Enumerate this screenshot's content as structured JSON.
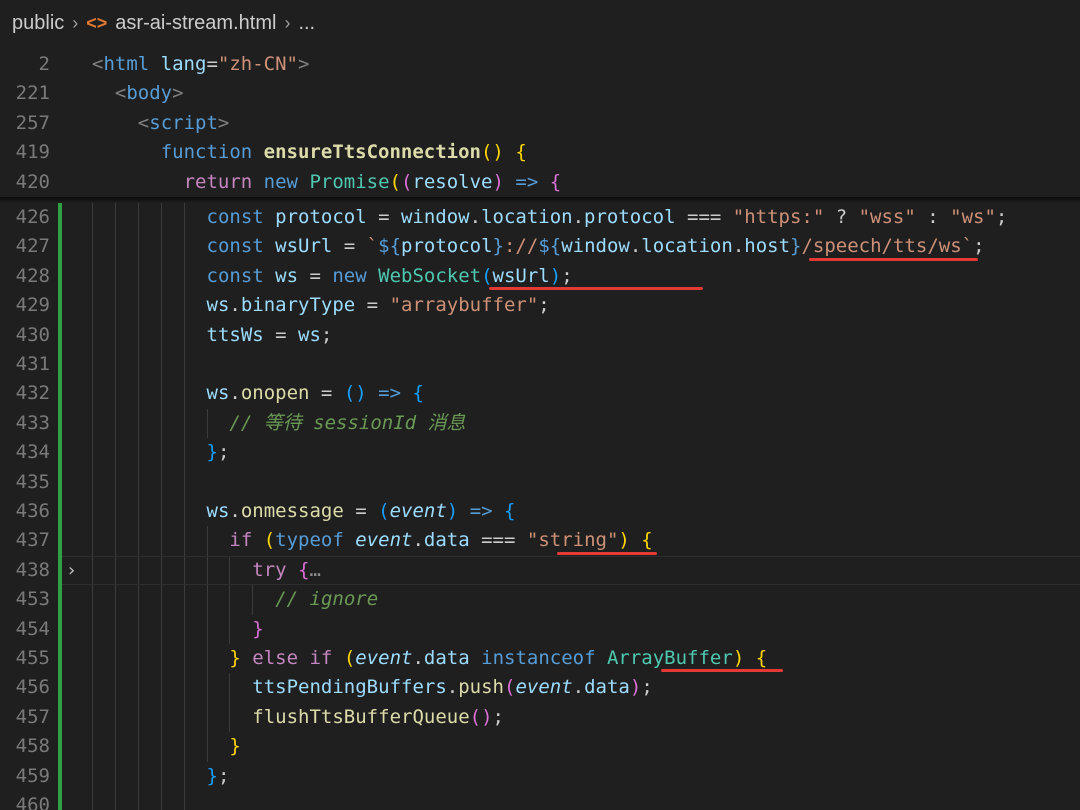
{
  "breadcrumb": {
    "folder": "public",
    "file": "asr-ai-stream.html",
    "more": "..."
  },
  "sticky": [
    {
      "ln": "2",
      "tokens": [
        {
          "c": "br",
          "t": "<"
        },
        {
          "c": "tag",
          "t": "html"
        },
        {
          "c": "sp",
          "t": " "
        },
        {
          "c": "attr",
          "t": "lang"
        },
        {
          "c": "pl",
          "t": "="
        },
        {
          "c": "str",
          "t": "\"zh-CN\""
        },
        {
          "c": "br",
          "t": ">"
        }
      ],
      "indent": 0
    },
    {
      "ln": "221",
      "tokens": [
        {
          "c": "br",
          "t": "<"
        },
        {
          "c": "tag",
          "t": "body"
        },
        {
          "c": "br",
          "t": ">"
        }
      ],
      "indent": 1
    },
    {
      "ln": "257",
      "tokens": [
        {
          "c": "br",
          "t": "<"
        },
        {
          "c": "tag",
          "t": "script"
        },
        {
          "c": "br",
          "t": ">"
        }
      ],
      "indent": 2
    },
    {
      "ln": "419",
      "tokens": [
        {
          "c": "kw",
          "t": "function "
        },
        {
          "c": "fnb",
          "t": "ensureTtsConnection"
        },
        {
          "c": "p1",
          "t": "()"
        },
        {
          "c": "pl",
          "t": " "
        },
        {
          "c": "p1",
          "t": "{"
        }
      ],
      "indent": 3
    },
    {
      "ln": "420",
      "tokens": [
        {
          "c": "ctl",
          "t": "return "
        },
        {
          "c": "kw",
          "t": "new "
        },
        {
          "c": "cls",
          "t": "Promise"
        },
        {
          "c": "p1",
          "t": "("
        },
        {
          "c": "p2",
          "t": "("
        },
        {
          "c": "var",
          "t": "resolve"
        },
        {
          "c": "p2",
          "t": ")"
        },
        {
          "c": "pl",
          "t": " "
        },
        {
          "c": "kw",
          "t": "=>"
        },
        {
          "c": "pl",
          "t": " "
        },
        {
          "c": "p2",
          "t": "{"
        }
      ],
      "indent": 4
    }
  ],
  "lines": [
    {
      "ln": "426",
      "indent": 5,
      "tokens": [
        {
          "c": "kw",
          "t": "const "
        },
        {
          "c": "var",
          "t": "protocol"
        },
        {
          "c": "pl",
          "t": " = "
        },
        {
          "c": "var",
          "t": "window"
        },
        {
          "c": "pl",
          "t": "."
        },
        {
          "c": "var",
          "t": "location"
        },
        {
          "c": "pl",
          "t": "."
        },
        {
          "c": "var",
          "t": "protocol"
        },
        {
          "c": "pl",
          "t": " === "
        },
        {
          "c": "str",
          "t": "\"https:\""
        },
        {
          "c": "pl",
          "t": " ? "
        },
        {
          "c": "str",
          "t": "\"wss\""
        },
        {
          "c": "pl",
          "t": " : "
        },
        {
          "c": "str",
          "t": "\"ws\""
        },
        {
          "c": "pl",
          "t": ";"
        }
      ]
    },
    {
      "ln": "427",
      "indent": 5,
      "tokens": [
        {
          "c": "kw",
          "t": "const "
        },
        {
          "c": "var",
          "t": "wsUrl"
        },
        {
          "c": "pl",
          "t": " = "
        },
        {
          "c": "str",
          "t": "`"
        },
        {
          "c": "kw",
          "t": "${"
        },
        {
          "c": "var",
          "t": "protocol"
        },
        {
          "c": "kw",
          "t": "}"
        },
        {
          "c": "str",
          "t": "://"
        },
        {
          "c": "kw",
          "t": "${"
        },
        {
          "c": "var",
          "t": "window"
        },
        {
          "c": "pl",
          "t": "."
        },
        {
          "c": "var",
          "t": "location"
        },
        {
          "c": "pl",
          "t": "."
        },
        {
          "c": "var",
          "t": "host"
        },
        {
          "c": "kw",
          "t": "}"
        },
        {
          "c": "str",
          "t": "/speech/tts/ws`"
        },
        {
          "c": "pl",
          "t": ";"
        }
      ]
    },
    {
      "ln": "428",
      "indent": 5,
      "tokens": [
        {
          "c": "kw",
          "t": "const "
        },
        {
          "c": "var",
          "t": "ws"
        },
        {
          "c": "pl",
          "t": " = "
        },
        {
          "c": "kw",
          "t": "new "
        },
        {
          "c": "cls",
          "t": "WebSocket"
        },
        {
          "c": "p3",
          "t": "("
        },
        {
          "c": "var",
          "t": "wsUrl"
        },
        {
          "c": "p3",
          "t": ")"
        },
        {
          "c": "pl",
          "t": ";"
        }
      ]
    },
    {
      "ln": "429",
      "indent": 5,
      "tokens": [
        {
          "c": "var",
          "t": "ws"
        },
        {
          "c": "pl",
          "t": "."
        },
        {
          "c": "var",
          "t": "binaryType"
        },
        {
          "c": "pl",
          "t": " = "
        },
        {
          "c": "str",
          "t": "\"arraybuffer\""
        },
        {
          "c": "pl",
          "t": ";"
        }
      ]
    },
    {
      "ln": "430",
      "indent": 5,
      "tokens": [
        {
          "c": "var",
          "t": "ttsWs"
        },
        {
          "c": "pl",
          "t": " = "
        },
        {
          "c": "var",
          "t": "ws"
        },
        {
          "c": "pl",
          "t": ";"
        }
      ]
    },
    {
      "ln": "431",
      "indent": 5,
      "tokens": []
    },
    {
      "ln": "432",
      "indent": 5,
      "tokens": [
        {
          "c": "var",
          "t": "ws"
        },
        {
          "c": "pl",
          "t": "."
        },
        {
          "c": "fn",
          "t": "onopen"
        },
        {
          "c": "pl",
          "t": " = "
        },
        {
          "c": "p3",
          "t": "()"
        },
        {
          "c": "pl",
          "t": " "
        },
        {
          "c": "kw",
          "t": "=>"
        },
        {
          "c": "pl",
          "t": " "
        },
        {
          "c": "p3",
          "t": "{"
        }
      ]
    },
    {
      "ln": "433",
      "indent": 6,
      "tokens": [
        {
          "c": "cm",
          "t": "// 等待 sessionId 消息"
        }
      ]
    },
    {
      "ln": "434",
      "indent": 5,
      "tokens": [
        {
          "c": "p3",
          "t": "}"
        },
        {
          "c": "pl",
          "t": ";"
        }
      ]
    },
    {
      "ln": "435",
      "indent": 5,
      "tokens": []
    },
    {
      "ln": "436",
      "indent": 5,
      "tokens": [
        {
          "c": "var",
          "t": "ws"
        },
        {
          "c": "pl",
          "t": "."
        },
        {
          "c": "fn",
          "t": "onmessage"
        },
        {
          "c": "pl",
          "t": " = "
        },
        {
          "c": "p3",
          "t": "("
        },
        {
          "c": "vari",
          "t": "event"
        },
        {
          "c": "p3",
          "t": ")"
        },
        {
          "c": "pl",
          "t": " "
        },
        {
          "c": "kw",
          "t": "=>"
        },
        {
          "c": "pl",
          "t": " "
        },
        {
          "c": "p3",
          "t": "{"
        }
      ]
    },
    {
      "ln": "437",
      "indent": 6,
      "tokens": [
        {
          "c": "ctl",
          "t": "if "
        },
        {
          "c": "p1",
          "t": "("
        },
        {
          "c": "kw",
          "t": "typeof "
        },
        {
          "c": "vari",
          "t": "event"
        },
        {
          "c": "pl",
          "t": "."
        },
        {
          "c": "var",
          "t": "data"
        },
        {
          "c": "pl",
          "t": " === "
        },
        {
          "c": "str",
          "t": "\"string\""
        },
        {
          "c": "p1",
          "t": ")"
        },
        {
          "c": "pl",
          "t": " "
        },
        {
          "c": "p1",
          "t": "{"
        }
      ]
    },
    {
      "ln": "438",
      "indent": 7,
      "tokens": [
        {
          "c": "ctl",
          "t": "try "
        },
        {
          "c": "p2",
          "t": "{"
        },
        {
          "c": "dim",
          "t": "…"
        }
      ]
    },
    {
      "ln": "453",
      "indent": 8,
      "tokens": [
        {
          "c": "cm",
          "t": "// ignore"
        }
      ]
    },
    {
      "ln": "454",
      "indent": 7,
      "tokens": [
        {
          "c": "p2",
          "t": "}"
        }
      ]
    },
    {
      "ln": "455",
      "indent": 6,
      "tokens": [
        {
          "c": "p1",
          "t": "}"
        },
        {
          "c": "pl",
          "t": " "
        },
        {
          "c": "ctl",
          "t": "else if "
        },
        {
          "c": "p1",
          "t": "("
        },
        {
          "c": "vari",
          "t": "event"
        },
        {
          "c": "pl",
          "t": "."
        },
        {
          "c": "var",
          "t": "data"
        },
        {
          "c": "pl",
          "t": " "
        },
        {
          "c": "kw",
          "t": "instanceof "
        },
        {
          "c": "cls",
          "t": "ArrayBuffer"
        },
        {
          "c": "p1",
          "t": ")"
        },
        {
          "c": "pl",
          "t": " "
        },
        {
          "c": "p1",
          "t": "{"
        }
      ]
    },
    {
      "ln": "456",
      "indent": 7,
      "tokens": [
        {
          "c": "var",
          "t": "ttsPendingBuffers"
        },
        {
          "c": "pl",
          "t": "."
        },
        {
          "c": "fn",
          "t": "push"
        },
        {
          "c": "p2",
          "t": "("
        },
        {
          "c": "vari",
          "t": "event"
        },
        {
          "c": "pl",
          "t": "."
        },
        {
          "c": "var",
          "t": "data"
        },
        {
          "c": "p2",
          "t": ")"
        },
        {
          "c": "pl",
          "t": ";"
        }
      ]
    },
    {
      "ln": "457",
      "indent": 7,
      "tokens": [
        {
          "c": "fn",
          "t": "flushTtsBufferQueue"
        },
        {
          "c": "p2",
          "t": "()"
        },
        {
          "c": "pl",
          "t": ";"
        }
      ]
    },
    {
      "ln": "458",
      "indent": 6,
      "tokens": [
        {
          "c": "p1",
          "t": "}"
        }
      ]
    },
    {
      "ln": "459",
      "indent": 5,
      "tokens": [
        {
          "c": "p3",
          "t": "}"
        },
        {
          "c": "pl",
          "t": ";"
        }
      ]
    },
    {
      "ln": "460",
      "indent": 5,
      "tokens": []
    }
  ],
  "colors": {
    "background": "#1f1f1f",
    "modified_bar": "#2ea043",
    "underline": "#e53935"
  }
}
